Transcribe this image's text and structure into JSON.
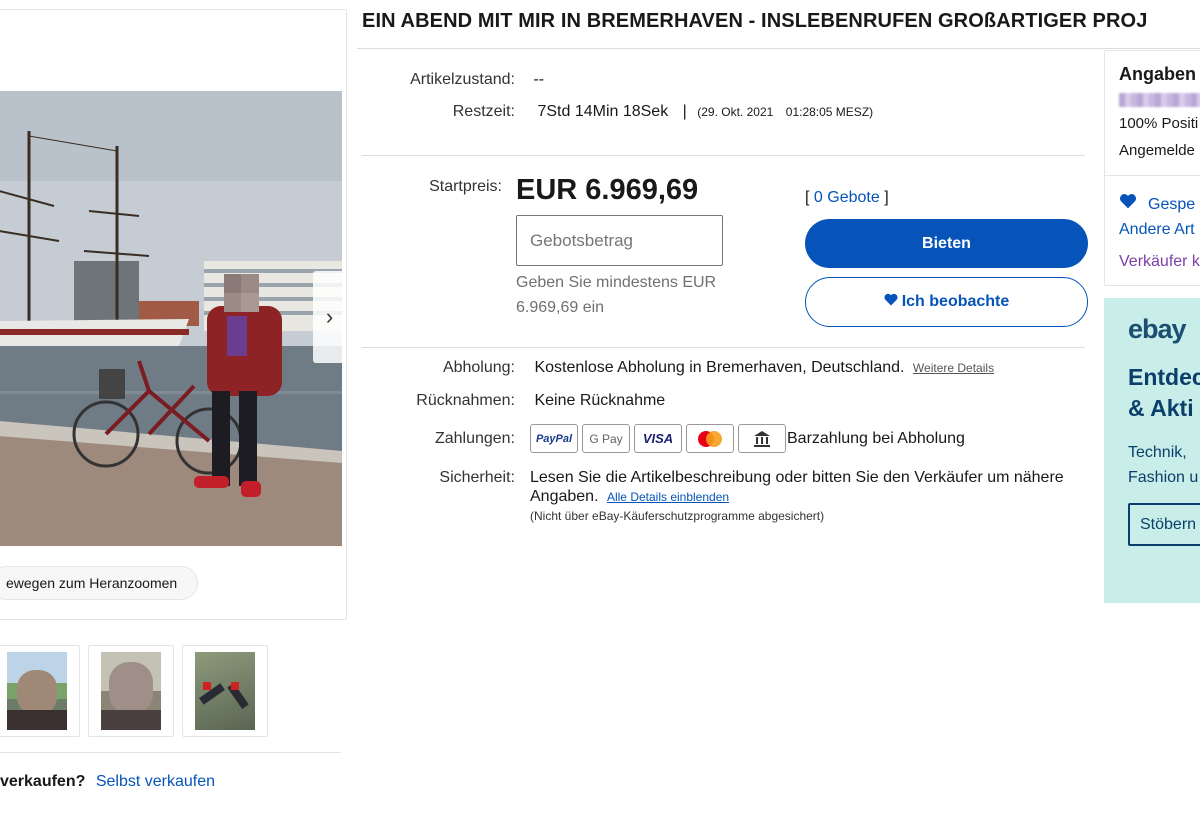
{
  "title": "EIN ABEND MIT MIR IN BREMERHAVEN - INSLEBENRUFEN GROßARTIGER PROJ",
  "gallery": {
    "next_arrow": "›",
    "zoom_hint": "ewegen zum Heranzoomen",
    "sell_question": "verkaufen?",
    "sell_link": "Selbst verkaufen"
  },
  "item": {
    "condition_label": "Artikelzustand:",
    "condition_value": "--",
    "time_label": "Restzeit:",
    "time_value": "7Std 14Min 18Sek",
    "time_sep": "|",
    "end_date": "(29. Okt. 2021",
    "end_time": "01:28:05 MESZ)"
  },
  "bidding": {
    "start_label": "Startpreis:",
    "price": "EUR 6.969,69",
    "bid_placeholder": "Gebotsbetrag",
    "bid_hint": "Geben Sie mindestens EUR 6.969,69 ein",
    "bids_open": "[",
    "bids_link": "0 Gebote",
    "bids_close": "]",
    "bid_button": "Bieten",
    "watch_button": "Ich beobachte"
  },
  "details": {
    "pickup_label": "Abholung:",
    "pickup_value": "Kostenlose Abholung in Bremerhaven, Deutschland.",
    "pickup_link": "Weitere Details",
    "returns_label": "Rücknahmen:",
    "returns_value": "Keine Rücknahme",
    "payments_label": "Zahlungen:",
    "payment_badges": [
      "PayPal",
      "G Pay",
      "VISA",
      "Mastercard",
      "Bank"
    ],
    "payment_text": "Barzahlung bei Abholung",
    "security_label": "Sicherheit:",
    "security_text": "Lesen Sie die Artikelbeschreibung oder bitten Sie den Verkäufer um nähere Angaben.",
    "security_link": "Alle Details einblenden",
    "security_note": "(Nicht über eBay-Käuferschutzprogramme abgesichert)"
  },
  "seller": {
    "heading": "Angaben",
    "positive": "100% Positi",
    "registered": "Angemelde",
    "saved": "Gespe",
    "other_items": "Andere Art",
    "contact": "Verkäufer k"
  },
  "ad": {
    "logo": "ebay",
    "headline_1": "Entdec",
    "headline_2": "& Akti",
    "text_1": "Technik,",
    "text_2": "Fashion u",
    "cta": "Stöbern"
  },
  "colors": {
    "link_blue": "#0654ba",
    "ad_background": "#c9ede8",
    "seller_purple": "#7b3fa7"
  }
}
